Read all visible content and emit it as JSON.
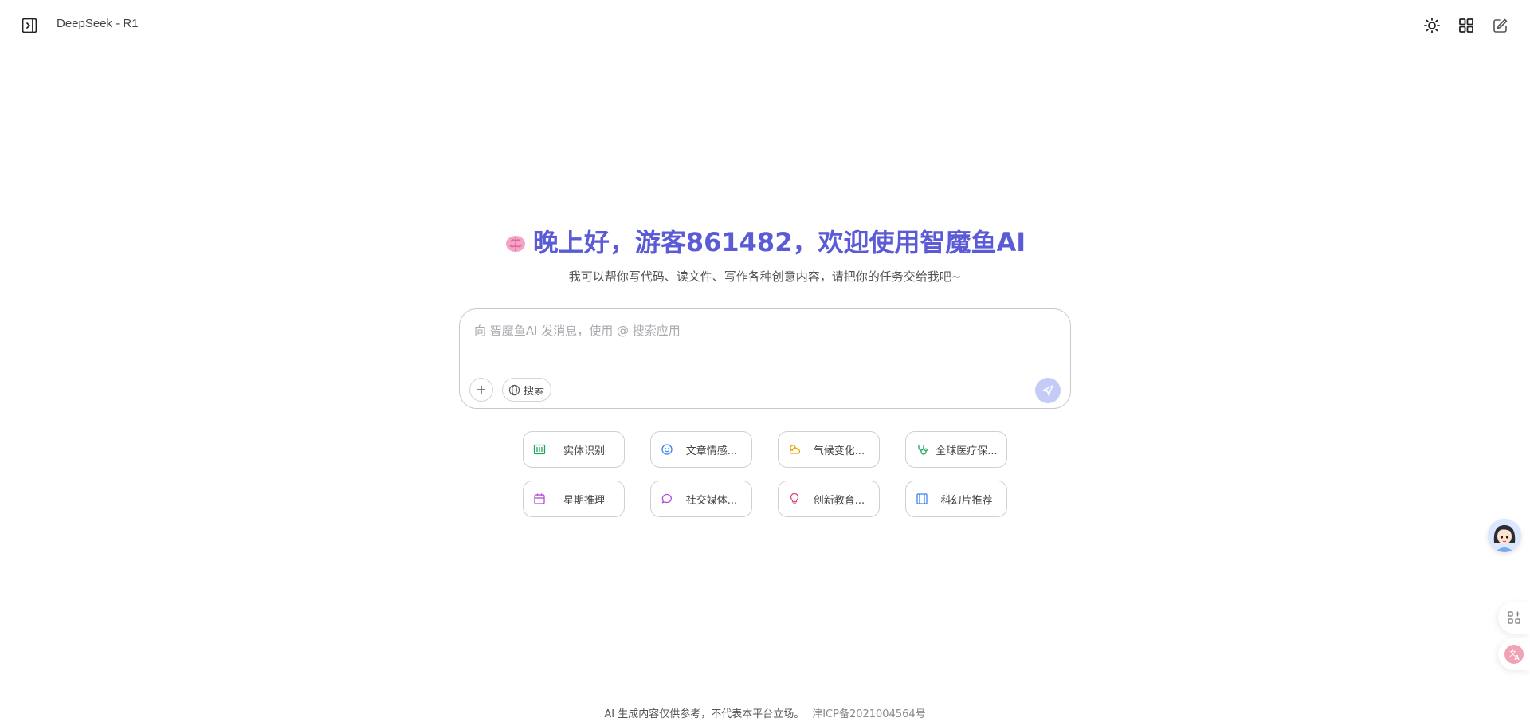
{
  "header": {
    "model_name": "DeepSeek - R1",
    "icons": [
      "sidebar-toggle-icon",
      "sun-icon",
      "apps-grid-icon",
      "new-chat-icon"
    ]
  },
  "welcome": {
    "greeting": "晚上好，游客861482，欢迎使用智魔鱼AI",
    "subtitle": "我可以帮你写代码、读文件、写作各种创意内容，请把你的任务交给我吧~",
    "accent_color": "#5b5bd6"
  },
  "composer": {
    "placeholder": "向 智魔鱼AI 发消息，使用 @ 搜索应用",
    "search_label": "搜索"
  },
  "suggestions": [
    {
      "label": "实体识别",
      "icon": "barcode-icon",
      "color": "#22a55b"
    },
    {
      "label": "文章情感...",
      "icon": "smile-icon",
      "color": "#3b82f6"
    },
    {
      "label": "气候变化...",
      "icon": "cloud-sun-icon",
      "color": "#e6a800"
    },
    {
      "label": "全球医疗保...",
      "icon": "stethoscope-icon",
      "color": "#22a55b"
    },
    {
      "label": "星期推理",
      "icon": "calendar-icon",
      "color": "#b04ad8"
    },
    {
      "label": "社交媒体...",
      "icon": "chat-bubble-icon",
      "color": "#b04ad8"
    },
    {
      "label": "创新教育...",
      "icon": "lightbulb-icon",
      "color": "#e0457b"
    },
    {
      "label": "科幻片推荐",
      "icon": "film-icon",
      "color": "#3b82f6"
    }
  ],
  "footer": {
    "disclaimer": "AI 生成内容仅供参考，不代表本平台立场。",
    "icp": "津ICP备2021004564号"
  }
}
